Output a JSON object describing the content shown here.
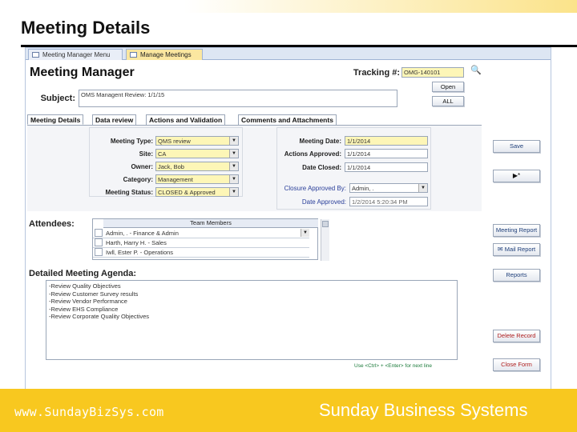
{
  "slide": {
    "title": "Meeting Details",
    "footer_url": "www.SundayBizSys.com",
    "footer_company": "Sunday Business Systems"
  },
  "doc_tabs": [
    "Meeting Manager Menu",
    "Manage Meetings"
  ],
  "form": {
    "title": "Meeting Manager",
    "tracking_label": "Tracking #:",
    "tracking_value": "OMG-140101",
    "subject_label": "Subject:",
    "subject_value": "OMS Managent Review: 1/1/15",
    "open_button": "Open",
    "all_button": "ALL"
  },
  "tabs": [
    "Meeting Details",
    "Data review",
    "Actions and Validation",
    "Comments and Attachments"
  ],
  "details": {
    "meeting_type_label": "Meeting Type:",
    "meeting_type_value": "QMS review",
    "site_label": "Site:",
    "site_value": "CA",
    "owner_label": "Owner:",
    "owner_value": "Jack, Bob",
    "category_label": "Category:",
    "category_value": "Management",
    "status_label": "Meeting Status:",
    "status_value": "CLOSED & Approved",
    "meeting_date_label": "Meeting Date:",
    "meeting_date_value": "1/1/2014",
    "actions_approved_label": "Actions Approved:",
    "actions_approved_value": "1/1/2014",
    "date_closed_label": "Date Closed:",
    "date_closed_value": "1/1/2014",
    "closure_approved_label": "Closure Approved By:",
    "closure_approved_value": "Admin, .",
    "date_approved_label": "Date Approved:",
    "date_approved_value": "1/2/2014 5:20:34 PM"
  },
  "attendees": {
    "label": "Attendees:",
    "header": "Team Members",
    "rows": [
      "Admin, . - Finance & Admin",
      "Harth, Harry H. - Sales",
      "Iwll, Ester P. - Operations"
    ]
  },
  "agenda": {
    "label": "Detailed Meeting Agenda:",
    "lines": [
      "-Review Quality Objectives",
      "-Review Customer Survey results",
      "-Review Vendor Performance",
      "-Review EHS Compliance",
      "-Review Corporate Quality Objectives"
    ],
    "hint": "Use <Ctrl> + <Enter> for next line"
  },
  "side_buttons": {
    "save": "Save",
    "new": "▶*",
    "meeting_report": "Meeting Report",
    "mail_report": "Mail Report",
    "reports": "Reports",
    "delete_record": "Delete Record",
    "close_form": "Close Form"
  },
  "colors": {
    "footer": "#f8c81f",
    "field_yellow": "#fdf6b7",
    "tab_active": "#fbe7a0"
  }
}
